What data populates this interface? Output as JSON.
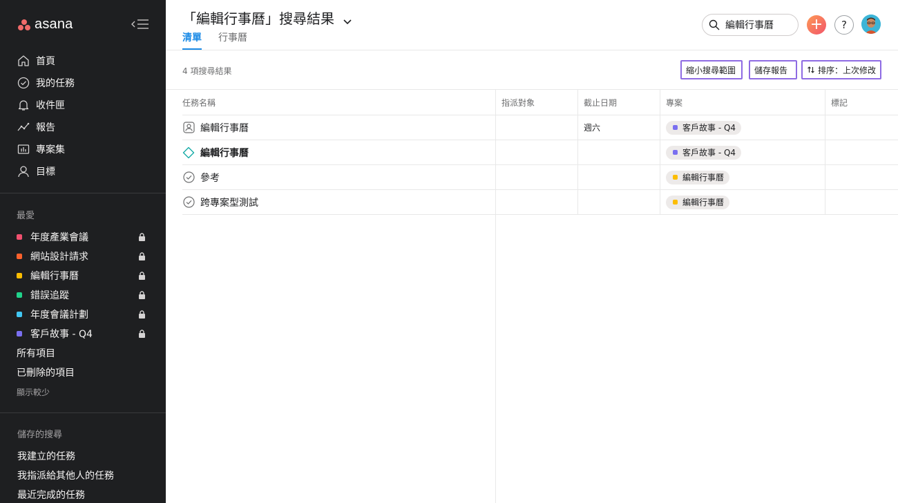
{
  "app": {
    "logo_text": "asana",
    "brand_color": "#f06a6a"
  },
  "sidebar": {
    "nav": [
      {
        "label": "首頁",
        "icon": "home-icon"
      },
      {
        "label": "我的任務",
        "icon": "check-circle-icon"
      },
      {
        "label": "收件匣",
        "icon": "bell-icon"
      },
      {
        "label": "報告",
        "icon": "chart-line-icon"
      },
      {
        "label": "專案集",
        "icon": "portfolio-icon"
      },
      {
        "label": "目標",
        "icon": "person-icon"
      }
    ],
    "favorites_title": "最愛",
    "favorites": [
      {
        "label": "年度產業會議",
        "color": "#f1506f"
      },
      {
        "label": "網站設計請求",
        "color": "#fd612c"
      },
      {
        "label": "編輯行事曆",
        "color": "#fcbd01"
      },
      {
        "label": "錯誤追蹤",
        "color": "#20d28a"
      },
      {
        "label": "年度會議計劃",
        "color": "#41c7f3"
      },
      {
        "label": "客戶故事 - Q4",
        "color": "#7a6ff0"
      }
    ],
    "all_items": "所有項目",
    "deleted_items": "已刪除的項目",
    "show_less": "顯示較少",
    "saved_title": "儲存的搜尋",
    "saved": [
      {
        "label": "我建立的任務"
      },
      {
        "label": "我指派給其他人的任務"
      },
      {
        "label": "最近完成的任務"
      }
    ]
  },
  "header": {
    "title": "「編輯行事曆」搜尋結果",
    "tabs": [
      {
        "label": "清單",
        "active": true
      },
      {
        "label": "行事曆",
        "active": false
      }
    ],
    "search_value": "編輯行事曆",
    "help_label": "?",
    "add_label": "+"
  },
  "toolbar": {
    "result_count": "4 項搜尋結果",
    "narrow_label": "縮小搜尋範圍",
    "save_label": "儲存報告",
    "sort_label": "排序：上次修改"
  },
  "table": {
    "columns": [
      "任務名稱",
      "指派對象",
      "截止日期",
      "專案",
      "標記"
    ],
    "rows": [
      {
        "icon": "approval-person-icon",
        "name": "編輯行事曆",
        "bold": false,
        "assignee": "",
        "due": "週六",
        "project": "客戶故事 - Q4",
        "project_color": "#7a6ff0",
        "tags": ""
      },
      {
        "icon": "milestone-diamond-icon",
        "name": "編輯行事曆",
        "bold": true,
        "assignee": "",
        "due": "",
        "project": "客戶故事 - Q4",
        "project_color": "#7a6ff0",
        "tags": ""
      },
      {
        "icon": "check-circle-icon",
        "name": "參考",
        "bold": false,
        "assignee": "",
        "due": "",
        "project": "編輯行事曆",
        "project_color": "#fcbd01",
        "tags": ""
      },
      {
        "icon": "check-circle-icon",
        "name": "跨專案型測試",
        "bold": false,
        "assignee": "",
        "due": "",
        "project": "編輯行事曆",
        "project_color": "#fcbd01",
        "tags": ""
      }
    ]
  }
}
